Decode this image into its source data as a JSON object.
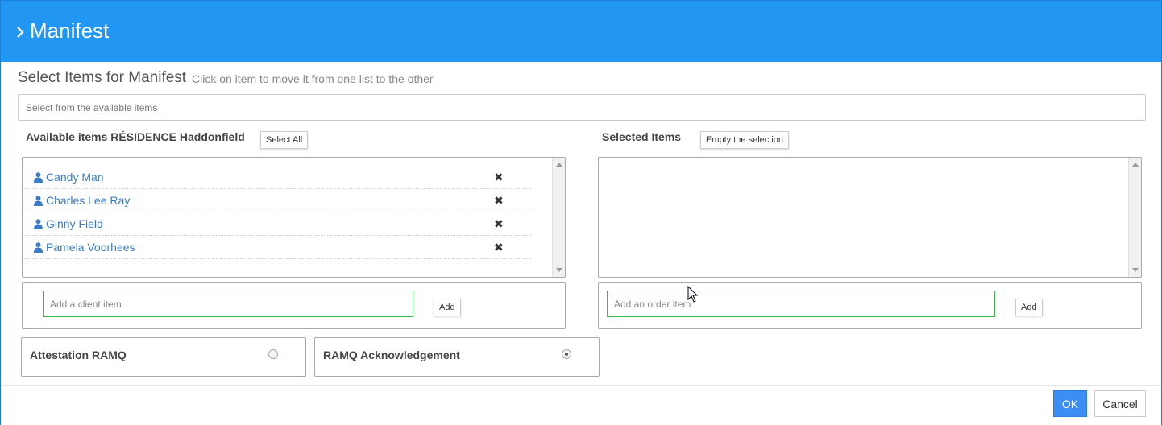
{
  "modal": {
    "title": "Manifest"
  },
  "section": {
    "title": "Select Items for Manifest",
    "hint": "Click on item to move it from one list to the other"
  },
  "search": {
    "placeholder": "Select from the available items"
  },
  "available": {
    "label": "Available items RÉSIDENCE Haddonfield",
    "select_all_label": "Select All",
    "items": [
      {
        "name": "Candy Man",
        "icon": "person-icon",
        "remove_icon": "close-icon"
      },
      {
        "name": "Charles Lee Ray",
        "icon": "person-icon",
        "remove_icon": "close-icon"
      },
      {
        "name": "Ginny Field",
        "icon": "person-icon",
        "remove_icon": "close-icon"
      },
      {
        "name": "Pamela Voorhees",
        "icon": "person-icon",
        "remove_icon": "close-icon"
      }
    ],
    "add_placeholder": "Add a client item",
    "add_label": "Add"
  },
  "selected": {
    "label": "Selected Items",
    "empty_label": "Empty the selection",
    "items": [],
    "add_placeholder": "Add an order item",
    "add_label": "Add"
  },
  "options": [
    {
      "label": "Attestation RAMQ",
      "checked": false
    },
    {
      "label": "RAMQ Acknowledgement",
      "checked": true
    }
  ],
  "footer": {
    "ok_label": "OK",
    "cancel_label": "Cancel"
  },
  "colors": {
    "header": "#2196f3",
    "link": "#3b7bc8",
    "primary_button": "#3c8ef5",
    "input_focus_border": "#3bb54a"
  }
}
